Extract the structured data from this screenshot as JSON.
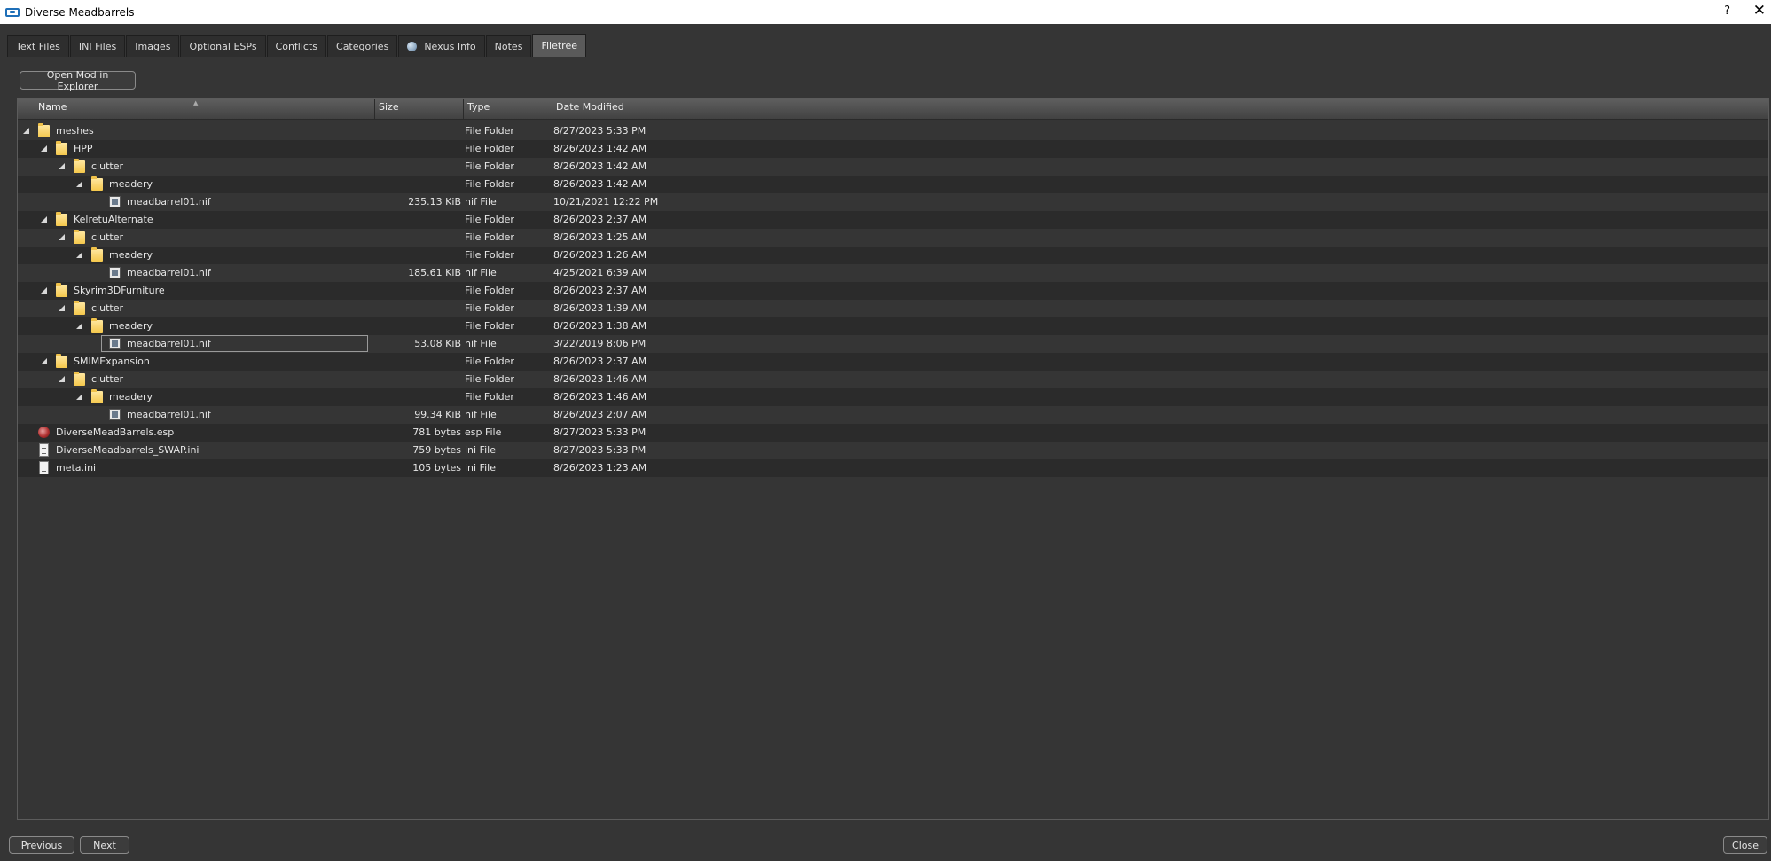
{
  "window": {
    "title": "Diverse Meadbarrels",
    "help": "?",
    "close": "✕"
  },
  "tabs": [
    {
      "label": "Text Files"
    },
    {
      "label": "INI Files"
    },
    {
      "label": "Images"
    },
    {
      "label": "Optional ESPs"
    },
    {
      "label": "Conflicts"
    },
    {
      "label": "Categories"
    },
    {
      "label": "Nexus Info"
    },
    {
      "label": "Notes"
    },
    {
      "label": "Filetree",
      "active": true
    }
  ],
  "toolbar": {
    "open_explorer_label": "Open Mod in Explorer"
  },
  "tree": {
    "columns": [
      "Name",
      "Size",
      "Type",
      "Date Modified"
    ],
    "rows": [
      {
        "name": "meshes",
        "size": "",
        "type": "File Folder",
        "date": "8/27/2023 5:33 PM"
      },
      {
        "name": "HPP",
        "size": "",
        "type": "File Folder",
        "date": "8/26/2023 1:42 AM"
      },
      {
        "name": "clutter",
        "size": "",
        "type": "File Folder",
        "date": "8/26/2023 1:42 AM"
      },
      {
        "name": "meadery",
        "size": "",
        "type": "File Folder",
        "date": "8/26/2023 1:42 AM"
      },
      {
        "name": "meadbarrel01.nif",
        "size": "235.13 KiB",
        "type": "nif File",
        "date": "10/21/2021 12:22 PM"
      },
      {
        "name": "KelretuAlternate",
        "size": "",
        "type": "File Folder",
        "date": "8/26/2023 2:37 AM"
      },
      {
        "name": "clutter",
        "size": "",
        "type": "File Folder",
        "date": "8/26/2023 1:25 AM"
      },
      {
        "name": "meadery",
        "size": "",
        "type": "File Folder",
        "date": "8/26/2023 1:26 AM"
      },
      {
        "name": "meadbarrel01.nif",
        "size": "185.61 KiB",
        "type": "nif File",
        "date": "4/25/2021 6:39 AM"
      },
      {
        "name": "Skyrim3DFurniture",
        "size": "",
        "type": "File Folder",
        "date": "8/26/2023 2:37 AM"
      },
      {
        "name": "clutter",
        "size": "",
        "type": "File Folder",
        "date": "8/26/2023 1:39 AM"
      },
      {
        "name": "meadery",
        "size": "",
        "type": "File Folder",
        "date": "8/26/2023 1:38 AM"
      },
      {
        "name": "meadbarrel01.nif",
        "size": "53.08 KiB",
        "type": "nif File",
        "date": "3/22/2019 8:06 PM"
      },
      {
        "name": "SMIMExpansion",
        "size": "",
        "type": "File Folder",
        "date": "8/26/2023 2:37 AM"
      },
      {
        "name": "clutter",
        "size": "",
        "type": "File Folder",
        "date": "8/26/2023 1:46 AM"
      },
      {
        "name": "meadery",
        "size": "",
        "type": "File Folder",
        "date": "8/26/2023 1:46 AM"
      },
      {
        "name": "meadbarrel01.nif",
        "size": "99.34 KiB",
        "type": "nif File",
        "date": "8/26/2023 2:07 AM"
      },
      {
        "name": "DiverseMeadBarrels.esp",
        "size": "781 bytes",
        "type": "esp File",
        "date": "8/27/2023 5:33 PM"
      },
      {
        "name": "DiverseMeadbarrels_SWAP.ini",
        "size": "759 bytes",
        "type": "ini File",
        "date": "8/27/2023 5:33 PM"
      },
      {
        "name": "meta.ini",
        "size": "105 bytes",
        "type": "ini File",
        "date": "8/26/2023 1:23 AM"
      }
    ]
  },
  "footer": {
    "previous_label": "Previous",
    "next_label": "Next",
    "close_label": "Close"
  }
}
